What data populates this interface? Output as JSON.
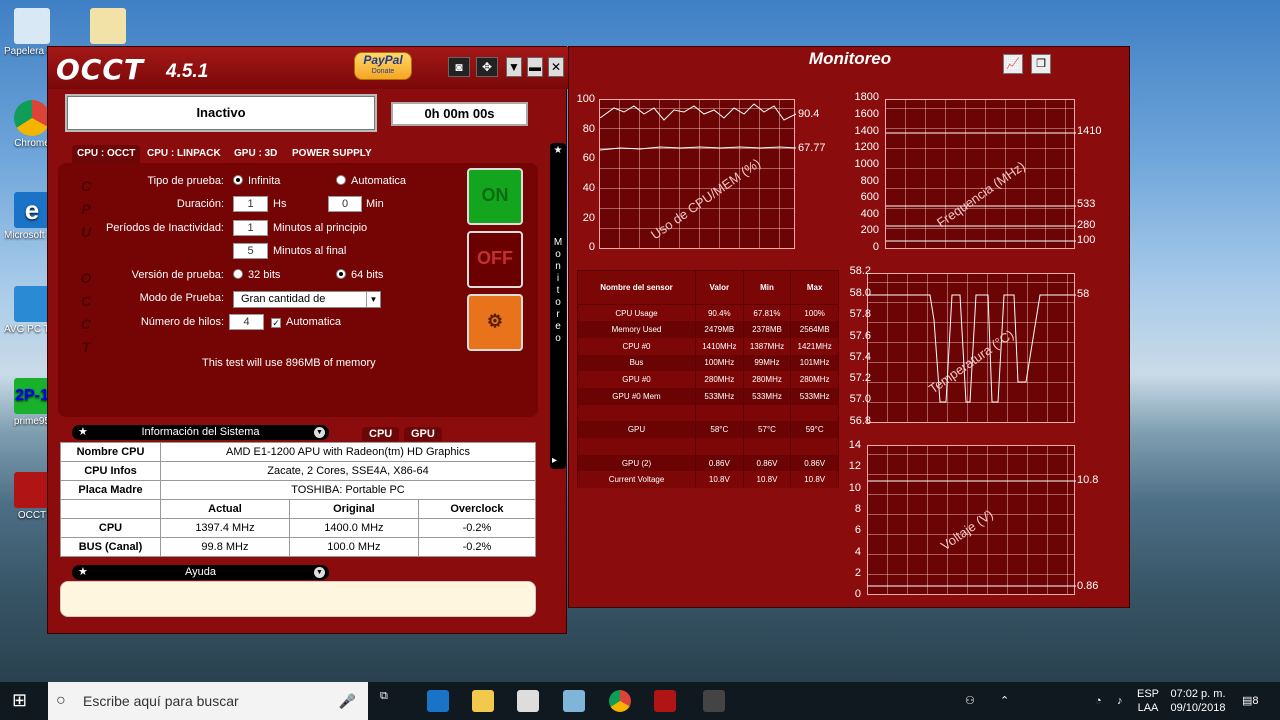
{
  "desktop": {
    "icons": [
      {
        "label": "Papelera de reciclaje",
        "color": "#d8e8f4"
      },
      {
        "label": "Chrome",
        "color": "#e8c64a"
      },
      {
        "label": "Microsoft Edge",
        "color": "#1a73c7"
      },
      {
        "label": "AVG PC TuneUp",
        "color": "#2a8ad3"
      },
      {
        "label": "prime95",
        "color": "#19b02c"
      },
      {
        "label": "OCCT",
        "color": "#b01414"
      }
    ]
  },
  "occt": {
    "title": "OCCT",
    "version": "4.5.1",
    "paypal_label": "PayPal",
    "paypal_sub": "Donate",
    "status": "Inactivo",
    "timer": "0h 00m 00s",
    "tabs": [
      "CPU : OCCT",
      "CPU : LINPACK",
      "GPU : 3D",
      "POWER SUPPLY"
    ],
    "side_text": "CPU OCCT",
    "form": {
      "test_type_label": "Tipo de prueba:",
      "test_type_infinite": "Infinita",
      "test_type_auto": "Automatica",
      "duration_label": "Duración:",
      "duration_hs": "1",
      "duration_hs_unit": "Hs",
      "duration_min": "0",
      "duration_min_unit": "Min",
      "idle_label": "Períodos de Inactividad:",
      "idle_start": "1",
      "idle_start_label": "Minutos al principio",
      "idle_end": "5",
      "idle_end_label": "Minutos al final",
      "version_label": "Versión de prueba:",
      "version_32": "32 bits",
      "version_64": "64 bits",
      "mode_label": "Modo de Prueba:",
      "mode_value": "Gran cantidad de",
      "threads_label": "Número de hilos:",
      "threads_value": "4",
      "threads_auto": "Automatica",
      "memory_note": "This test will use 896MB of memory"
    },
    "buttons": {
      "on": "ON",
      "off": "OFF"
    },
    "sysinfo": {
      "header": "Información del Sistema",
      "tabs": [
        "CPU",
        "GPU"
      ],
      "rows": [
        {
          "label": "Nombre CPU",
          "value": "AMD E1-1200 APU with Radeon(tm) HD Graphics"
        },
        {
          "label": "CPU Infos",
          "value": "Zacate, 2 Cores, SSE4A, X86-64"
        },
        {
          "label": "Placa Madre",
          "value": "TOSHIBA: Portable PC"
        }
      ],
      "clock_headers": [
        "Actual",
        "Original",
        "Overclock"
      ],
      "clock_rows": [
        {
          "label": "CPU",
          "actual": "1397.4 MHz",
          "original": "1400.0 MHz",
          "overclock": "-0.2%"
        },
        {
          "label": "BUS (Canal)",
          "actual": "99.8 MHz",
          "original": "100.0 MHz",
          "overclock": "-0.2%"
        }
      ]
    },
    "help_header": "Ayuda",
    "monitor_tab": "Monitoreo"
  },
  "monitor": {
    "title": "Monitoreo",
    "cpu_mem_chart": {
      "title": "Uso de CPU/MEM (%)",
      "yticks": [
        "100",
        "80",
        "60",
        "40",
        "20",
        "0"
      ],
      "right_labels": [
        "90.4",
        "67.77"
      ]
    },
    "freq_chart": {
      "title": "Frequencia (MHz)",
      "yticks": [
        "1800",
        "1600",
        "1400",
        "1200",
        "1000",
        "800",
        "600",
        "400",
        "200",
        "0"
      ],
      "right_labels": [
        "1410",
        "533",
        "280",
        "100"
      ]
    },
    "temp_chart": {
      "title": "Temperatura (°C)",
      "yticks": [
        "58.2",
        "58.0",
        "57.8",
        "57.6",
        "57.4",
        "57.2",
        "57.0",
        "56.8"
      ],
      "right_labels": [
        "58"
      ]
    },
    "volt_chart": {
      "title": "Voltaje (V)",
      "yticks": [
        "14",
        "12",
        "10",
        "8",
        "6",
        "4",
        "2",
        "0"
      ],
      "right_labels": [
        "10.8",
        "0.86"
      ]
    },
    "sensor_table": {
      "headers": [
        "Nombre del sensor",
        "Valor",
        "Min",
        "Max"
      ],
      "rows": [
        [
          "CPU Usage",
          "90.4%",
          "67.81%",
          "100%"
        ],
        [
          "Memory Used",
          "2479MB",
          "2378MB",
          "2564MB"
        ],
        [
          "CPU #0",
          "1410MHz",
          "1387MHz",
          "1421MHz"
        ],
        [
          "Bus",
          "100MHz",
          "99MHz",
          "101MHz"
        ],
        [
          "GPU #0",
          "280MHz",
          "280MHz",
          "280MHz"
        ],
        [
          "GPU #0 Mem",
          "533MHz",
          "533MHz",
          "533MHz"
        ],
        [
          "",
          "",
          "",
          ""
        ],
        [
          "GPU",
          "58°C",
          "57°C",
          "59°C"
        ],
        [
          "",
          "",
          "",
          ""
        ],
        [
          "GPU (2)",
          "0.86V",
          "0.86V",
          "0.86V"
        ],
        [
          "Current Voltage",
          "10.8V",
          "10.8V",
          "10.8V"
        ]
      ]
    }
  },
  "taskbar": {
    "search_placeholder": "Escribe aquí para buscar",
    "language": "ESP",
    "language_sub": "LAA",
    "time": "07:02 p. m.",
    "date": "09/10/2018",
    "notifications": "8"
  }
}
